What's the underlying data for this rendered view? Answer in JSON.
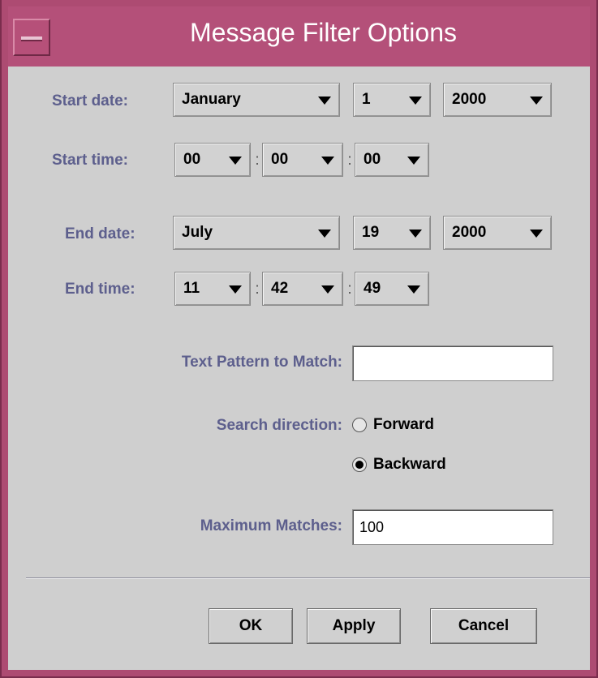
{
  "window": {
    "title": "Message Filter Options"
  },
  "months": {
    "start": "January",
    "end": "July"
  },
  "start_date": {
    "label": "Start date:",
    "day": "1",
    "year": "2000"
  },
  "start_time": {
    "label": "Start time:",
    "hour": "00",
    "minute": "00",
    "second": "00"
  },
  "end_date": {
    "label": "End date:",
    "day": "19",
    "year": "2000"
  },
  "end_time": {
    "label": "End time:",
    "hour": "11",
    "minute": "42",
    "second": "49"
  },
  "time_separator": ":",
  "pattern": {
    "label": "Text Pattern to Match:",
    "value": ""
  },
  "direction": {
    "label": "Search direction:",
    "options": [
      {
        "label": "Forward",
        "selected": false
      },
      {
        "label": "Backward",
        "selected": true
      }
    ]
  },
  "max_matches": {
    "label": "Maximum Matches:",
    "value": "100"
  },
  "buttons": {
    "ok": "OK",
    "apply": "Apply",
    "cancel": "Cancel"
  },
  "colors": {
    "titlebar": "#b45079",
    "label_text": "#5d5f8d",
    "background": "#cfcfcf"
  }
}
